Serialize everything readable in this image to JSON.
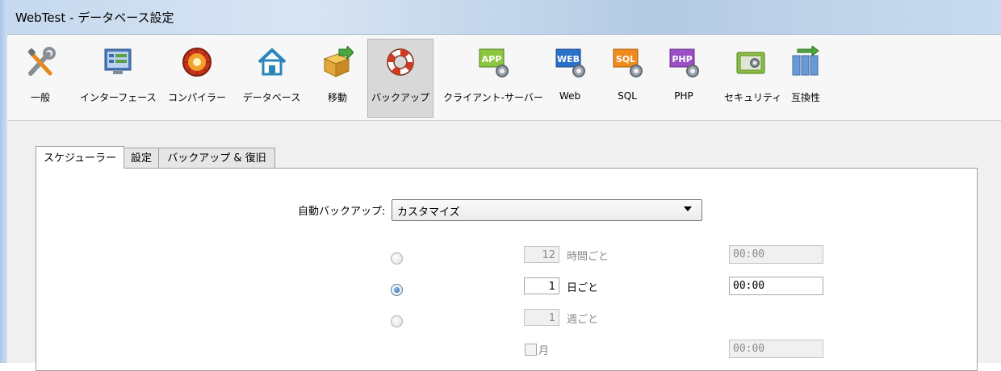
{
  "window": {
    "title": "WebTest - データベース設定"
  },
  "toolbar": {
    "items": [
      {
        "label": "一般",
        "icon": "wrench-icon"
      },
      {
        "label": "インターフェース",
        "icon": "interface-icon"
      },
      {
        "label": "コンパイラー",
        "icon": "compiler-icon"
      },
      {
        "label": "データベース",
        "icon": "home-icon"
      },
      {
        "label": "移動",
        "icon": "move-box-icon"
      },
      {
        "label": "バックアップ",
        "icon": "lifebuoy-icon",
        "selected": true
      },
      {
        "label": "クライアント-サーバー",
        "icon": "app-server-icon"
      },
      {
        "label": "Web",
        "icon": "web-server-icon"
      },
      {
        "label": "SQL",
        "icon": "sql-server-icon"
      },
      {
        "label": "PHP",
        "icon": "php-server-icon"
      },
      {
        "label": "セキュリティ",
        "icon": "security-icon"
      },
      {
        "label": "互換性",
        "icon": "compatibility-icon"
      }
    ]
  },
  "tabs": [
    {
      "label": "スケジューラー",
      "selected": true
    },
    {
      "label": "設定"
    },
    {
      "label": "バックアップ & 復旧"
    }
  ],
  "scheduler": {
    "auto_backup_label": "自動バックアップ:",
    "auto_backup_value": "カスタマイズ",
    "rows": [
      {
        "selected": false,
        "value": "12",
        "unit": "時間ごと",
        "time": "00:00",
        "enabled": false
      },
      {
        "selected": true,
        "value": "1",
        "unit": "日ごと",
        "time": "00:00",
        "enabled": true
      },
      {
        "selected": false,
        "value": "1",
        "unit": "週ごと",
        "enabled": false
      }
    ],
    "month": {
      "label": "月",
      "checked": false,
      "time": "00:00",
      "enabled": false
    }
  },
  "colors": {
    "selected_tool_bg": "#d8d8d8",
    "radio_selected": "#1e5aa0"
  }
}
